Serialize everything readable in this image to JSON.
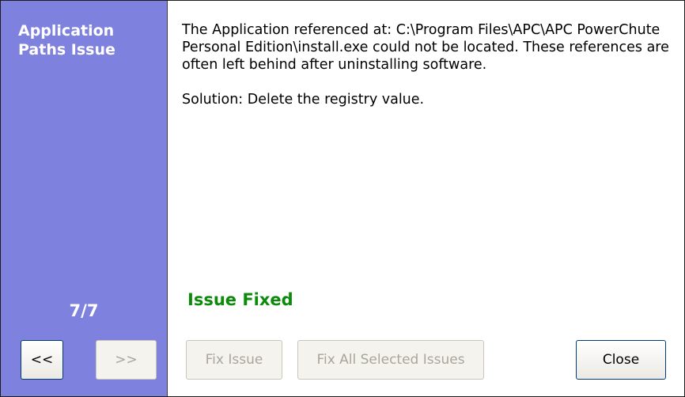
{
  "sidebar": {
    "title": "Application Paths Issue",
    "page_counter": "7/7",
    "prev_button": "<<",
    "next_button": ">>"
  },
  "issue": {
    "description": "The Application referenced at: C:\\Program Files\\APC\\APC PowerChute Personal Edition\\install.exe could not be located. These references are often left behind after uninstalling software.",
    "solution": "Solution: Delete the registry value.",
    "status": "Issue Fixed"
  },
  "actions": {
    "fix_issue": "Fix Issue",
    "fix_all": "Fix All Selected Issues",
    "close": "Close"
  },
  "colors": {
    "sidebar_bg": "#7f81de",
    "status_green": "#0b8a0b"
  }
}
